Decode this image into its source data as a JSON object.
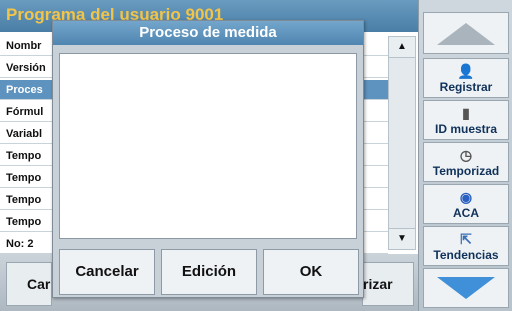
{
  "background": {
    "title": "Programa del usuario   9001",
    "rows": [
      "Nombr",
      "Versión",
      "Proces",
      "Fórmul",
      "Variabl",
      "Tempo",
      "Tempo",
      "Tempo",
      "Tempo",
      "No: 2"
    ],
    "selected_row": 2,
    "bottom_left_label": "Car",
    "bottom_right_label": "rizar"
  },
  "right_panel": {
    "buttons": [
      {
        "label": "Registrar",
        "icon": "person-icon"
      },
      {
        "label": "ID muestra",
        "icon": "sample-id-icon"
      },
      {
        "label": "Temporizad",
        "icon": "timer-icon"
      },
      {
        "label": "ACA",
        "icon": "aca-icon"
      },
      {
        "label": "Tendencias",
        "icon": "trend-icon"
      }
    ]
  },
  "dialog": {
    "title": "Proceso de medida",
    "buttons": {
      "cancel": "Cancelar",
      "edit": "Edición",
      "ok": "OK"
    }
  }
}
